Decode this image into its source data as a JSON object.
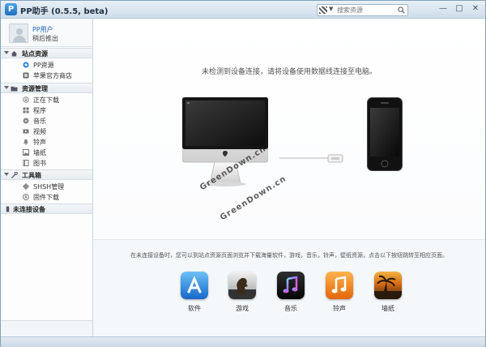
{
  "window": {
    "title": "PP助手 (0.5.5, beta)",
    "app_icon_letter": "P",
    "search_placeholder": "搜索资源",
    "buttons": {
      "minimize": "—",
      "maximize": "□",
      "close": "✕"
    }
  },
  "user": {
    "name": "PP用户",
    "action": "稍后推出"
  },
  "sidebar": {
    "sections": [
      {
        "label": "站点资源",
        "icon": "home-icon",
        "items": [
          {
            "label": "PP资源",
            "icon": "pp-icon"
          },
          {
            "label": "苹果官方商店",
            "icon": "store-icon"
          }
        ]
      },
      {
        "label": "资源管理",
        "icon": "folder-icon",
        "items": [
          {
            "label": "正在下载",
            "icon": "download-icon"
          },
          {
            "label": "程序",
            "icon": "app-icon"
          },
          {
            "label": "音乐",
            "icon": "music-icon"
          },
          {
            "label": "视频",
            "icon": "video-icon"
          },
          {
            "label": "铃声",
            "icon": "bell-icon"
          },
          {
            "label": "墙纸",
            "icon": "picture-icon"
          },
          {
            "label": "图书",
            "icon": "book-icon"
          }
        ]
      },
      {
        "label": "工具箱",
        "icon": "toolbox-icon",
        "items": [
          {
            "label": "SHSH管理",
            "icon": "shsh-icon"
          },
          {
            "label": "固件下载",
            "icon": "firmware-icon"
          }
        ]
      }
    ],
    "device_section": {
      "label": "未连接设备",
      "icon": "device-icon"
    }
  },
  "main": {
    "notice": "未检测到设备连接，请将设备使用数据线连接至电脑。",
    "watermark": "GreenDown.cn",
    "hint": "在未连接设备时，您可以到站点资源页面浏览并下载海量软件，游戏，音乐，铃声，壁纸资源，点击以下按钮跳转至相应页面。",
    "shortcuts": [
      {
        "label": "软件",
        "icon": "appstore-icon"
      },
      {
        "label": "游戏",
        "icon": "game-center-icon"
      },
      {
        "label": "音乐",
        "icon": "music-note-icon"
      },
      {
        "label": "铃声",
        "icon": "ringtone-icon"
      },
      {
        "label": "墙纸",
        "icon": "wallpaper-icon"
      }
    ]
  },
  "colors": {
    "accent": "#1f63b5",
    "border": "#7fa3bf"
  }
}
